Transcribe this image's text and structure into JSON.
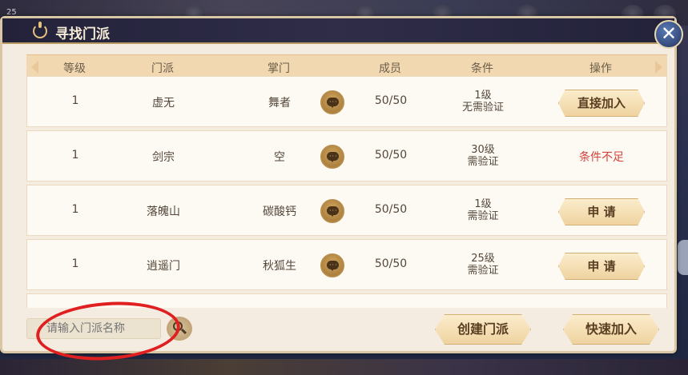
{
  "hud": {
    "level": "25"
  },
  "dialog": {
    "title": "寻找门派",
    "close_label": "✕"
  },
  "table": {
    "headers": [
      "等级",
      "门派",
      "掌门",
      "成员",
      "条件",
      "操作"
    ],
    "rows": [
      {
        "level": "1",
        "sect": "虚无",
        "leader": "舞者",
        "members": "50/50",
        "cond_line1": "1级",
        "cond_line2": "无需验证",
        "action": "直接加入",
        "action_type": "button"
      },
      {
        "level": "1",
        "sect": "剑宗",
        "leader": "空",
        "members": "50/50",
        "cond_line1": "30级",
        "cond_line2": "需验证",
        "action": "条件不足",
        "action_type": "status"
      },
      {
        "level": "1",
        "sect": "落魄山",
        "leader": "碳酸钙",
        "members": "50/50",
        "cond_line1": "1级",
        "cond_line2": "需验证",
        "action": "申 请",
        "action_type": "button"
      },
      {
        "level": "1",
        "sect": "逍遥门",
        "leader": "秋狐生",
        "members": "50/50",
        "cond_line1": "25级",
        "cond_line2": "需验证",
        "action": "申 请",
        "action_type": "button"
      }
    ]
  },
  "footer": {
    "search_placeholder": "请输入门派名称",
    "create_label": "创建门派",
    "quick_join_label": "快速加入"
  },
  "colors": {
    "panel_bg": "#f4ece0",
    "header_bg": "#f1d8b0",
    "fail_text": "#d3413a",
    "annotation_circle": "#e02020"
  }
}
